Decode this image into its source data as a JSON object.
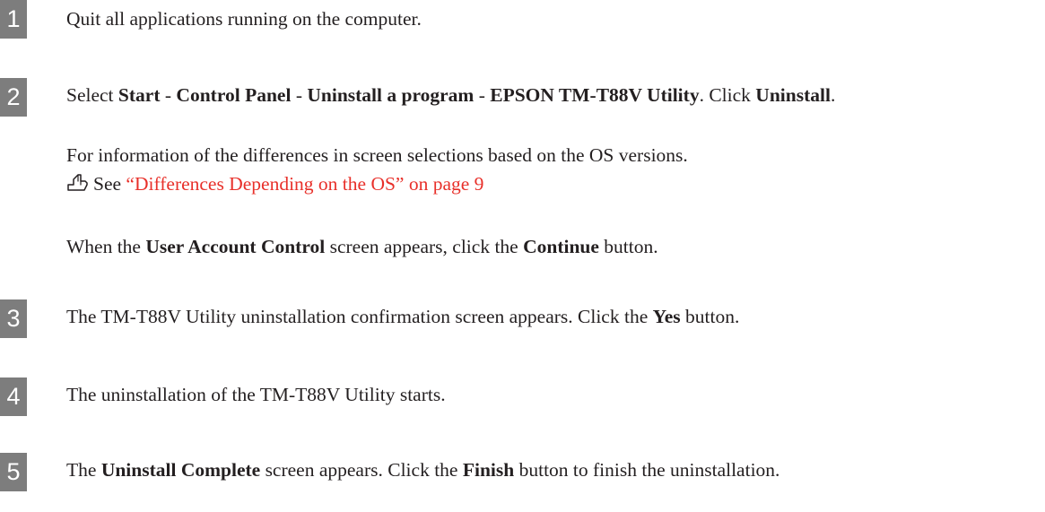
{
  "steps": [
    {
      "number": "1",
      "text": "Quit all applications running on the computer."
    },
    {
      "number": "2",
      "main": {
        "p1": "Select ",
        "b1": "Start",
        "p2": " - ",
        "b2": "Control Panel",
        "p3": " - ",
        "b3": "Uninstall a program",
        "p4": " - ",
        "b4": "EPSON TM-T88V Utility",
        "p5": ". Click ",
        "b5": "Uninstall",
        "p6": "."
      },
      "note": "For information of the differences in screen selections based on the OS versions.",
      "xref": {
        "see": "See ",
        "link": "“Differences Depending on the OS” on page 9"
      },
      "uac": {
        "p1": "When the ",
        "b1": "User Account Control",
        "p2": " screen appears, click the ",
        "b2": "Continue",
        "p3": " button."
      }
    },
    {
      "number": "3",
      "main": {
        "p1": "The TM-T88V Utility uninstallation confirmation screen appears. Click the ",
        "b1": "Yes",
        "p2": " button."
      }
    },
    {
      "number": "4",
      "text": "The uninstallation of the TM-T88V Utility starts."
    },
    {
      "number": "5",
      "main": {
        "p1": "The ",
        "b1": "Uninstall Complete",
        "p2": " screen appears. Click the ",
        "b2": "Finish",
        "p3": " button to finish the uninstallation."
      }
    }
  ]
}
